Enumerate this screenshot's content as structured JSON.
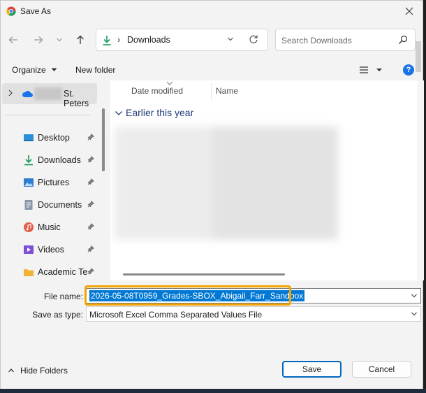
{
  "window": {
    "title": "Save As"
  },
  "address": {
    "location": "Downloads",
    "separator": "›"
  },
  "search": {
    "placeholder": "Search Downloads"
  },
  "commands": {
    "organize": "Organize",
    "new_folder": "New folder",
    "help": "?"
  },
  "nav": {
    "top_item": {
      "label": "St. Peters"
    },
    "items": [
      {
        "label": "Desktop",
        "icon": "desktop-icon",
        "color": "#2b8fd9"
      },
      {
        "label": "Downloads",
        "icon": "download-icon",
        "color": "#1a9b57"
      },
      {
        "label": "Pictures",
        "icon": "pictures-icon",
        "color": "#2f7fd1"
      },
      {
        "label": "Documents",
        "icon": "documents-icon",
        "color": "#8a96a8"
      },
      {
        "label": "Music",
        "icon": "music-icon",
        "color": "#e25d4a"
      },
      {
        "label": "Videos",
        "icon": "videos-icon",
        "color": "#7b4fd6"
      },
      {
        "label": "Academic Te",
        "icon": "folder-icon",
        "color": "#f2b233"
      }
    ]
  },
  "files": {
    "columns": [
      "Date modified",
      "Name"
    ],
    "group": "Earlier this year"
  },
  "form": {
    "file_name_label": "File name:",
    "file_name_value": "2026-05-08T0959_Grades-SBOX_Abigail_Farr_Sandbox",
    "save_type_label": "Save as type:",
    "save_type_value": "Microsoft Excel Comma Separated Values File"
  },
  "footer": {
    "hide_folders": "Hide Folders",
    "save": "Save",
    "cancel": "Cancel"
  },
  "colors": {
    "accent": "#0078d4",
    "highlight_ring": "#f0a500"
  }
}
